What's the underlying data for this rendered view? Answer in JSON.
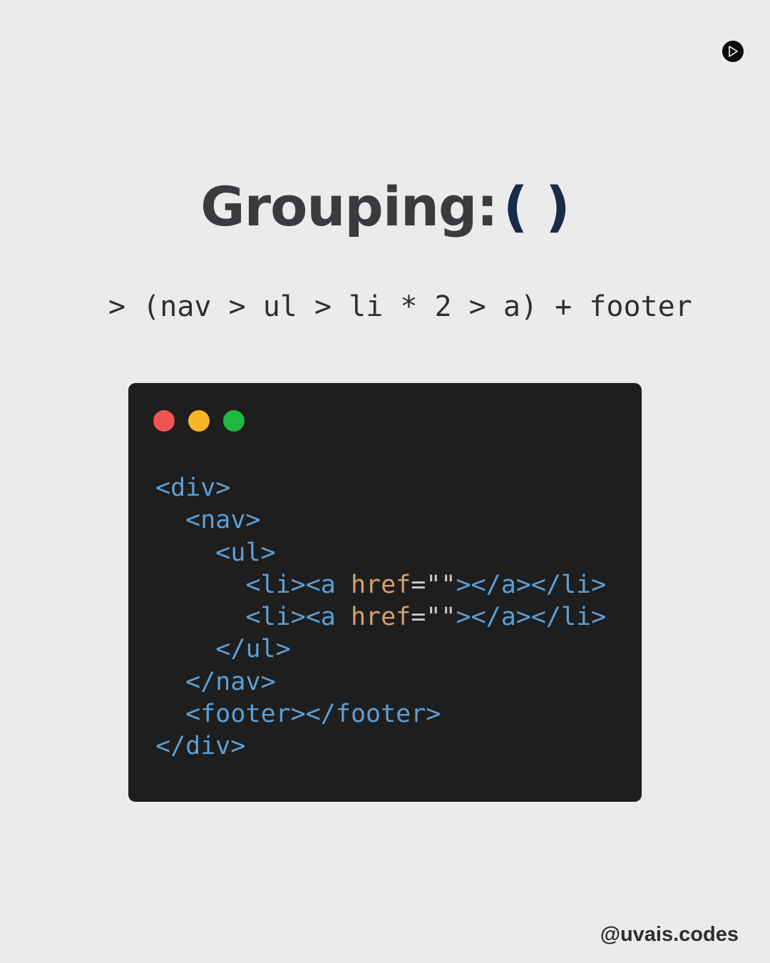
{
  "title": {
    "text": "Grouping:",
    "symbol": "( )"
  },
  "command": "> (nav > ul > li * 2 > a) + footer",
  "editor": {
    "lines": [
      {
        "indent": "",
        "segments": [
          {
            "text": "<div>",
            "kind": "tag"
          }
        ]
      },
      {
        "indent": "  ",
        "segments": [
          {
            "text": "<nav>",
            "kind": "tag"
          }
        ]
      },
      {
        "indent": "    ",
        "segments": [
          {
            "text": "<ul>",
            "kind": "tag"
          }
        ]
      },
      {
        "indent": "      ",
        "segments": [
          {
            "text": "<li><a ",
            "kind": "tag"
          },
          {
            "text": "href",
            "kind": "attr"
          },
          {
            "text": "=",
            "kind": "str"
          },
          {
            "text": "\"\"",
            "kind": "str"
          },
          {
            "text": "></a></li>",
            "kind": "tag"
          }
        ]
      },
      {
        "indent": "      ",
        "segments": [
          {
            "text": "<li><a ",
            "kind": "tag"
          },
          {
            "text": "href",
            "kind": "attr"
          },
          {
            "text": "=",
            "kind": "str"
          },
          {
            "text": "\"\"",
            "kind": "str"
          },
          {
            "text": "></a></li>",
            "kind": "tag"
          }
        ]
      },
      {
        "indent": "    ",
        "segments": [
          {
            "text": "</ul>",
            "kind": "tag"
          }
        ]
      },
      {
        "indent": "  ",
        "segments": [
          {
            "text": "</nav>",
            "kind": "tag"
          }
        ]
      },
      {
        "indent": "  ",
        "segments": [
          {
            "text": "<footer></footer>",
            "kind": "tag"
          }
        ]
      },
      {
        "indent": "",
        "segments": [
          {
            "text": "</div>",
            "kind": "tag"
          }
        ]
      }
    ]
  },
  "handle": "@uvais.codes",
  "icons": {
    "next": "play-arrow-icon"
  },
  "colors": {
    "background": "#ebebeb",
    "title": "#3a3b3f",
    "title_accent": "#1a2b4a",
    "editor_bg": "#1e1e1e",
    "tag": "#5c9fd6",
    "attr": "#d7a16a",
    "string": "#c9c9c9",
    "dot_red": "#ee5451",
    "dot_yellow": "#f8b526",
    "dot_green": "#1fb940"
  }
}
